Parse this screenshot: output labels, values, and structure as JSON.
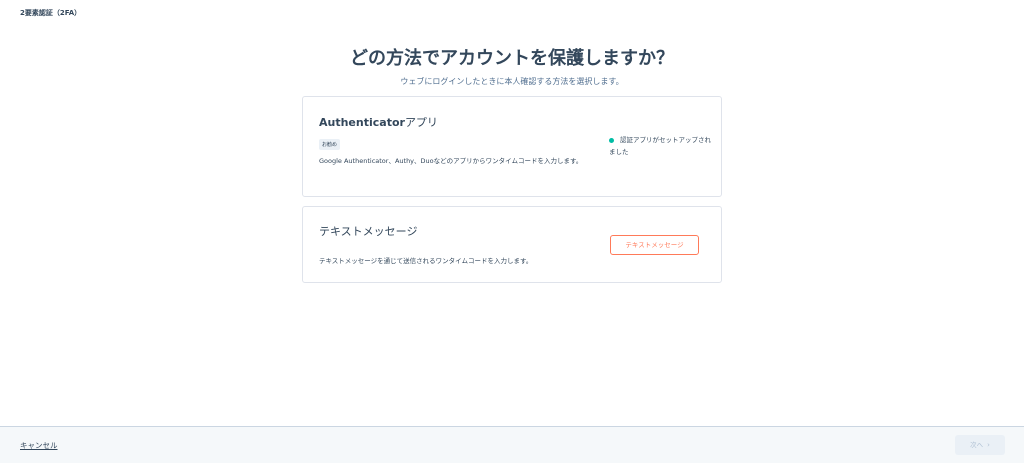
{
  "header": {
    "title": "2要素認証（2FA）"
  },
  "main": {
    "heading": "どの方法でアカウントを保護しますか？",
    "subheading": "ウェブにログインしたときに本人確認する方法を選択します。"
  },
  "methods": [
    {
      "title_bold": "Authenticator",
      "title_rest": "アプリ",
      "badge": "お勧め",
      "description": "Google Authenticator、Authy、Duoなどのアプリからワンタイムコードを入力します。",
      "status_text": "認証アプリがセットアップされました",
      "status_color": "#00bda5"
    },
    {
      "title": "テキストメッセージ",
      "description": "テキストメッセージを通じて送信されるワンタイムコードを入力します。",
      "button_label": "テキストメッセージ",
      "button_color": "#ff7a59"
    }
  ],
  "footer": {
    "cancel_label": "キャンセル",
    "next_label": "次へ",
    "next_icon": "chevron-right-icon"
  }
}
